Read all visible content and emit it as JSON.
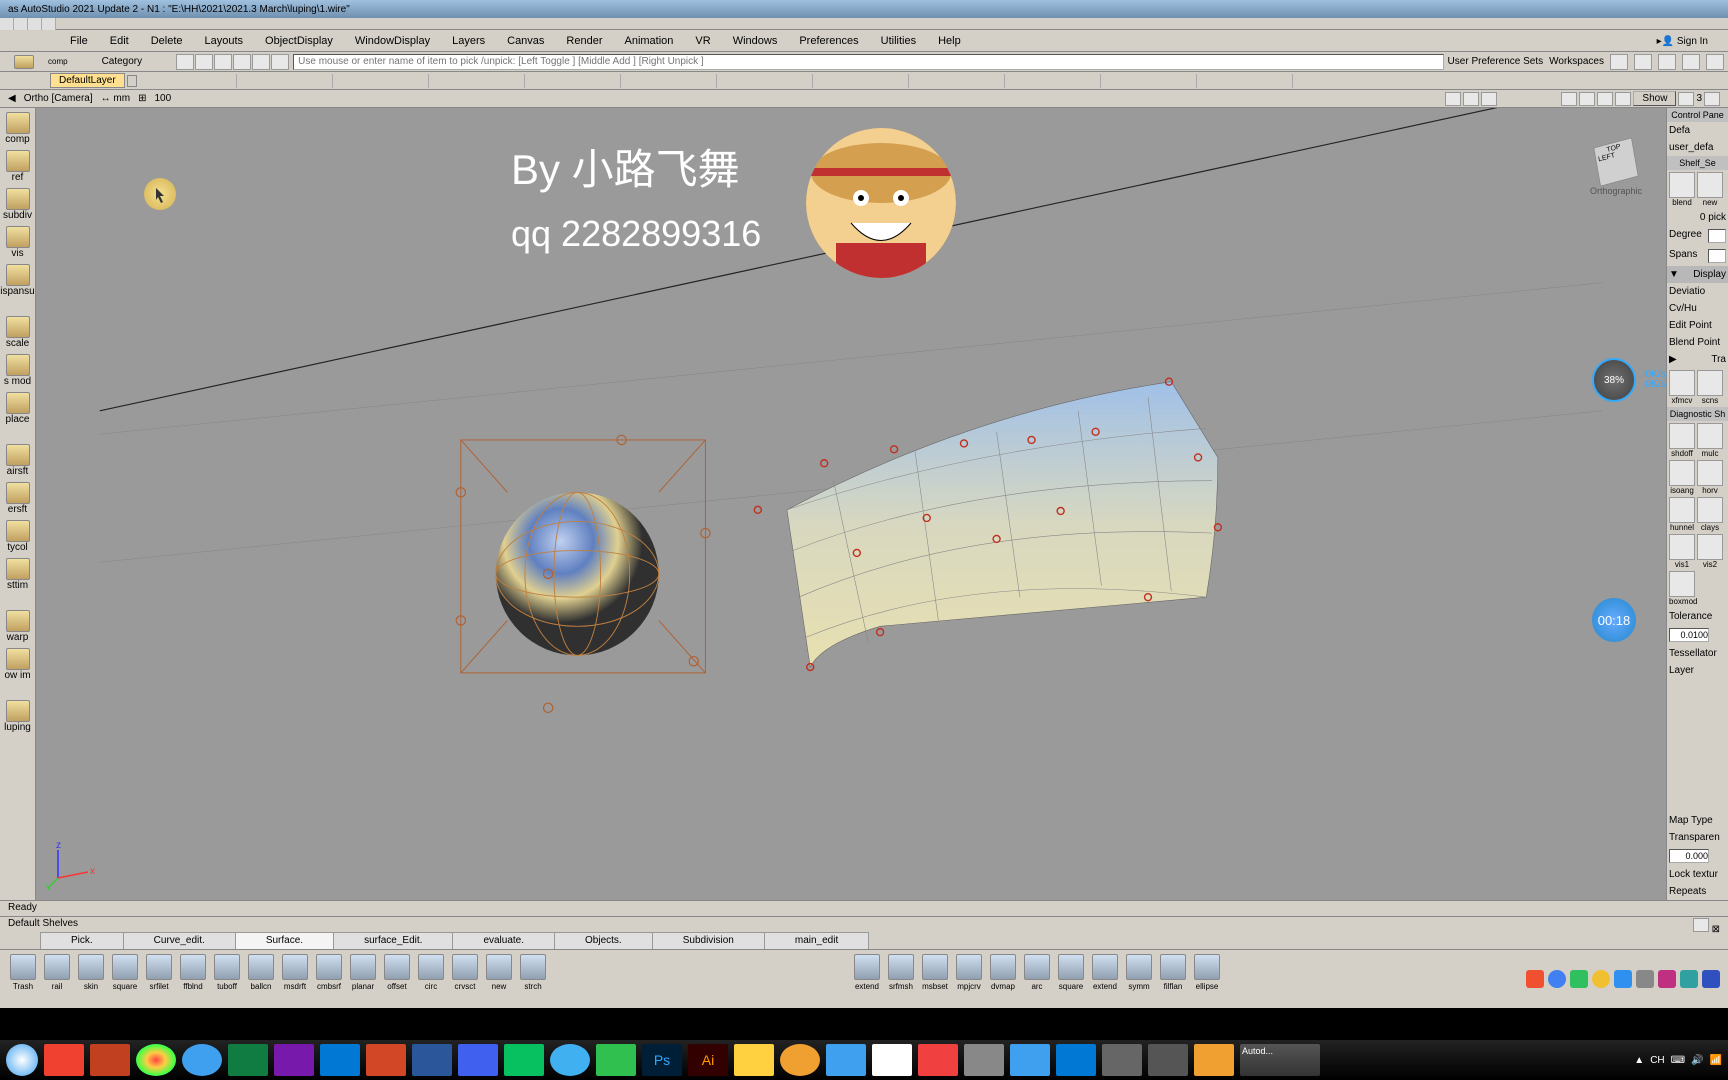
{
  "app": {
    "title": "as AutoStudio 2021 Update 2    - N1 : \"E:\\HH\\2021\\2021.3 March\\luping\\1.wire\""
  },
  "menu": [
    "File",
    "Edit",
    "Delete",
    "Layouts",
    "ObjectDisplay",
    "WindowDisplay",
    "Layers",
    "Canvas",
    "Render",
    "Animation",
    "VR",
    "Windows",
    "Preferences",
    "Utilities",
    "Help"
  ],
  "signin": "Sign In",
  "pickbar": {
    "comp": "comp",
    "category": "Category",
    "placeholder": "Use mouse or enter name of item to pick /unpick: [Left Toggle ] [Middle Add ] [Right Unpick ]",
    "prefs": "User Preference Sets",
    "workspaces": "Workspaces"
  },
  "layer": {
    "default": "DefaultLayer"
  },
  "viewbar": {
    "ortho": "Ortho [Camera]",
    "unit": "mm",
    "val": "100",
    "show": "Show",
    "num": "3"
  },
  "left_tools": [
    "comp",
    "ref",
    "subdiv",
    "vis",
    "ispansu",
    "",
    "scale",
    "s mod",
    "place",
    "",
    "airsft",
    "ersft",
    "tycol",
    "sttim",
    "",
    "warp",
    "ow im",
    "",
    "luping"
  ],
  "overlay": {
    "line1": "By  小路飞舞",
    "line2": "qq  2282899316"
  },
  "viewcube": {
    "top": "TOP",
    "left": "LEFT",
    "mode": "Orthographic"
  },
  "badges": {
    "b1": "38%",
    "b1s1": "0K/s",
    "b1s2": "0K/s",
    "b2": "00:18"
  },
  "status": "Ready",
  "shelves_title": "Default Shelves",
  "shelf_tabs": [
    "Pick.",
    "Curve_edit.",
    "Surface.",
    "surface_Edit.",
    "evaluate.",
    "Objects.",
    "Subdivision",
    "main_edit"
  ],
  "shelf_active": 2,
  "shelf_tools_left": [
    "Trash",
    "rail",
    "skin",
    "square",
    "srfilet",
    "ffblnd",
    "tuboff",
    "ballcn",
    "msdrft",
    "cmbsrf",
    "planar",
    "offset",
    "circ",
    "crvsct",
    "new",
    "strch"
  ],
  "shelf_tools_right": [
    "extend",
    "srfmsh",
    "msbset",
    "mpjcrv",
    "dvmap",
    "arc",
    "square",
    "extend",
    "symm",
    "filflan",
    "ellipse"
  ],
  "right_panel": {
    "control": "Control Pane",
    "defa": "Defa",
    "user": "user_defa",
    "shelf": "Shelf_Se",
    "blend": "blend",
    "new": "new",
    "pick": "0 pick",
    "degree": "Degree",
    "spans": "Spans",
    "display": "Display",
    "deviation": "Deviatio",
    "cvhu": "Cv/Hu",
    "editpt": "Edit Point",
    "blendpt": "Blend Point",
    "tra": "Tra",
    "xfmcv": "xfmcv",
    "scns": "scns",
    "diag": "Diagnostic Sh",
    "diag_tools": [
      "shdoff",
      "mulc",
      "isoang",
      "horv",
      "hunnel",
      "clays",
      "vis1",
      "vis2",
      "boxmod"
    ],
    "tolerance": "Tolerance",
    "tol_val": "0.0100",
    "tessellator": "Tessellator",
    "layer_lbl": "Layer",
    "maptype": "Map Type",
    "transp": "Transparen",
    "transp_val": "0.000",
    "lock": "Lock textur",
    "repeats": "Repeats"
  }
}
